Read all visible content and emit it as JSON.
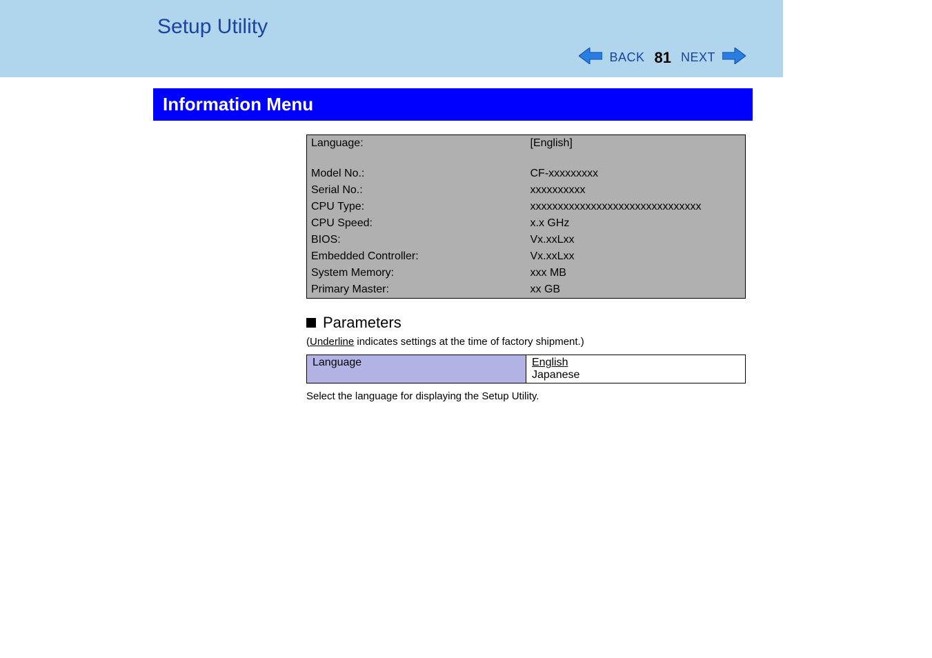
{
  "header": {
    "title": "Setup Utility",
    "back_label": "BACK",
    "next_label": "NEXT",
    "page_number": "81"
  },
  "section": {
    "title": "Information Menu"
  },
  "info_rows": [
    {
      "label": "Language:",
      "value": "[English]"
    }
  ],
  "info_rows2": [
    {
      "label": "Model No.:",
      "value": "CF-xxxxxxxxx"
    },
    {
      "label": "Serial No.:",
      "value": "xxxxxxxxxx"
    },
    {
      "label": "CPU Type:",
      "value": "xxxxxxxxxxxxxxxxxxxxxxxxxxxxxxx"
    },
    {
      "label": "CPU Speed:",
      "value": "x.x GHz"
    },
    {
      "label": "BIOS:",
      "value": "Vx.xxLxx"
    },
    {
      "label": "Embedded Controller:",
      "value": "Vx.xxLxx"
    },
    {
      "label": "System Memory:",
      "value": "xxx MB"
    },
    {
      "label": "Primary Master:",
      "value": "xx GB"
    }
  ],
  "parameters": {
    "heading": "Parameters",
    "note_prefix": "(",
    "note_underline": "Underline",
    "note_suffix": " indicates settings at the time of factory shipment.)",
    "rows": [
      {
        "name": "Language",
        "default": "English",
        "other": "Japanese"
      }
    ],
    "description": "Select the language for displaying the Setup Utility."
  }
}
